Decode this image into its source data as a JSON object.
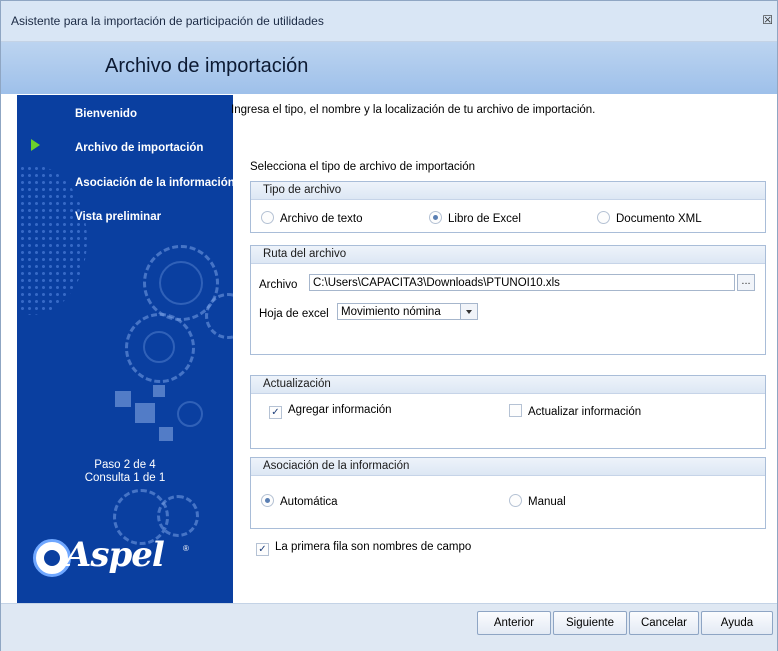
{
  "window": {
    "title": "Asistente para la importación de participación de utilidades",
    "close_glyph": "☒"
  },
  "header": {
    "title": "Archivo de importación"
  },
  "sidebar": {
    "items": [
      {
        "label": "Bienvenido",
        "active": false
      },
      {
        "label": "Archivo de importación",
        "active": true
      },
      {
        "label": "Asociación de la información",
        "active": false
      },
      {
        "label": "Vista preliminar",
        "active": false
      }
    ],
    "active_icon": "green-arrow-icon",
    "step": "Paso 2 de 4",
    "consulta": "Consulta 1 de 1",
    "logo_text": "Aspel",
    "logo_reg": "®"
  },
  "content": {
    "intro": "Ingresa el tipo, el nombre y la localización de tu archivo de importación.",
    "select_label": "Selecciona el tipo de archivo de importación",
    "file_type": {
      "header": "Tipo de archivo",
      "options": [
        {
          "label": "Archivo de texto",
          "selected": false
        },
        {
          "label": "Libro de Excel",
          "selected": true
        },
        {
          "label": "Documento XML",
          "selected": false
        }
      ]
    },
    "file_path": {
      "header": "Ruta del archivo",
      "archivo_label": "Archivo",
      "archivo_value": "C:\\Users\\CAPACITA3\\Downloads\\PTUNOI10.xls",
      "browse_label": "...",
      "hoja_label": "Hoja de excel",
      "hoja_value": "Movimiento nómina"
    },
    "update": {
      "header": "Actualización",
      "agregar": {
        "label": "Agregar información",
        "checked": true
      },
      "actualizar": {
        "label": "Actualizar información",
        "checked": false
      }
    },
    "association": {
      "header": "Asociación de la información",
      "options": [
        {
          "label": "Automática",
          "selected": true
        },
        {
          "label": "Manual",
          "selected": false
        }
      ]
    },
    "first_row": {
      "label": "La primera fila son nombres de campo",
      "checked": true
    },
    "check_mark": "✓"
  },
  "buttons": {
    "anterior": "Anterior",
    "siguiente": "Siguiente",
    "cancelar": "Cancelar",
    "ayuda": "Ayuda"
  },
  "colors": {
    "sidebar": "#0a3fa0",
    "header": "#9ec0ea",
    "active_arrow": "#6bd12a"
  }
}
